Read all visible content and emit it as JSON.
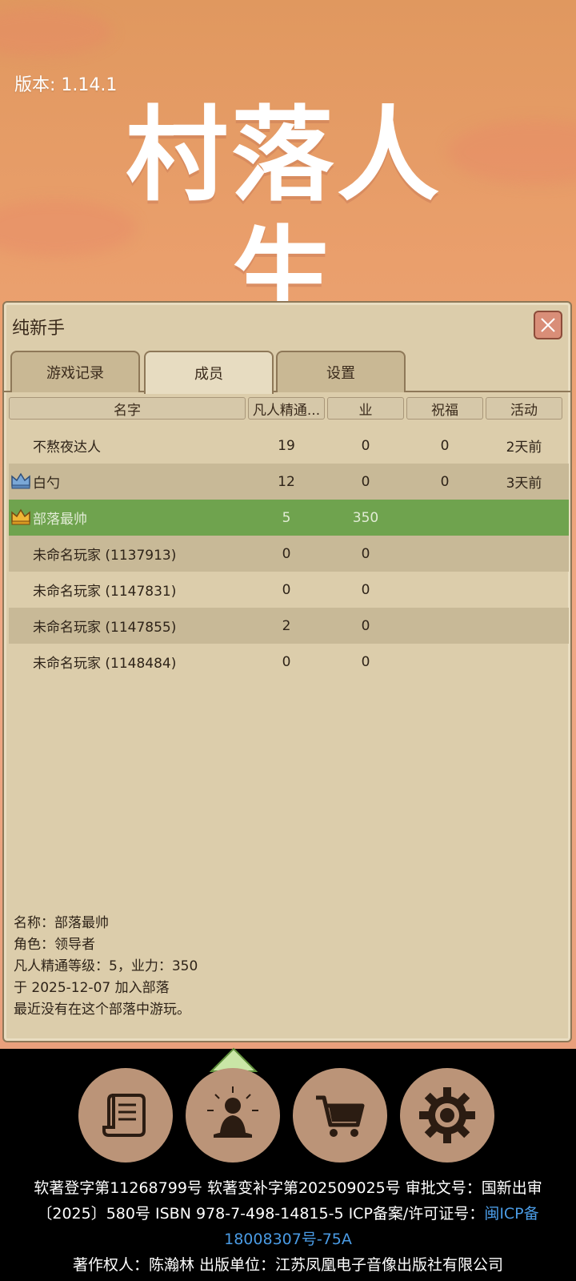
{
  "app": {
    "version": "版本: 1.14.1",
    "logo_text": "村落人生"
  },
  "panel": {
    "title": "纯新手",
    "close_icon": "close-icon",
    "tabs": [
      {
        "label": "游戏记录",
        "active": false
      },
      {
        "label": "成员",
        "active": true
      },
      {
        "label": "设置",
        "active": false
      }
    ],
    "columns": [
      "名字",
      "凡人精通...",
      "业",
      "祝福",
      "活动"
    ],
    "rows": [
      {
        "name": "不熬夜达人",
        "mastery": "19",
        "karma": "0",
        "blessing": "0",
        "activity": "2天前",
        "role_icon": ""
      },
      {
        "name": "白勺",
        "mastery": "12",
        "karma": "0",
        "blessing": "0",
        "activity": "3天前",
        "role_icon": "blue-crown-icon"
      },
      {
        "name": "部落最帅",
        "mastery": "5",
        "karma": "350",
        "blessing": "",
        "activity": "",
        "role_icon": "gold-crown-icon"
      },
      {
        "name": "未命名玩家 (1137913)",
        "mastery": "0",
        "karma": "0",
        "blessing": "",
        "activity": "",
        "role_icon": ""
      },
      {
        "name": "未命名玩家 (1147831)",
        "mastery": "0",
        "karma": "0",
        "blessing": "",
        "activity": "",
        "role_icon": ""
      },
      {
        "name": "未命名玩家 (1147855)",
        "mastery": "2",
        "karma": "0",
        "blessing": "",
        "activity": "",
        "role_icon": ""
      },
      {
        "name": "未命名玩家 (1148484)",
        "mastery": "0",
        "karma": "0",
        "blessing": "",
        "activity": "",
        "role_icon": ""
      }
    ],
    "details": {
      "name_line": "名称：部落最帅",
      "role_line": "角色：领导者",
      "stats_line": "凡人精通等级：5，业力：350",
      "joined_line": "于 2025-12-07 加入部落",
      "activity_line": "最近没有在这个部落中游玩。"
    }
  },
  "bottom_nav": [
    {
      "icon": "scroll-icon"
    },
    {
      "icon": "meditation-icon"
    },
    {
      "icon": "cart-icon"
    },
    {
      "icon": "gear-icon"
    }
  ],
  "footer": {
    "line1": "软著登字第11268799号 软著变补字第202509025号 审批文号：国新出审",
    "line2": "〔2025〕580号 ISBN 978-7-498-14815-5 ICP备案/许可证号：",
    "link_part1": "闽ICP备",
    "link_part2": "18008307号-75A",
    "line3": "著作权人：陈瀚林 出版单位：江苏凤凰电子音像出版社有限公司"
  },
  "colors": {
    "panel_bg": "#dccdab",
    "selected_row": "#6fa34e",
    "link": "#4a9be4"
  }
}
